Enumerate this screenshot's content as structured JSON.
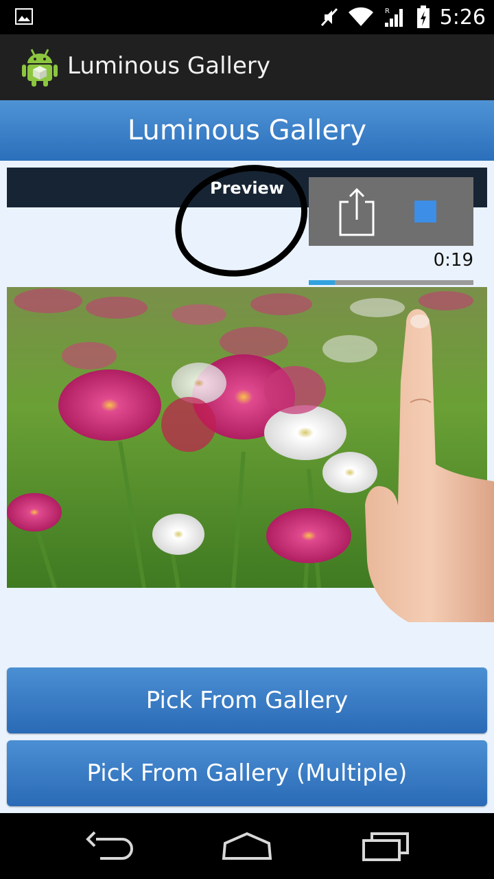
{
  "status_bar": {
    "time": "5:26",
    "icons": [
      "gallery-icon",
      "mute-icon",
      "wifi-icon",
      "signal-icon",
      "battery-charging-icon"
    ]
  },
  "action_bar": {
    "title": "Luminous Gallery",
    "icon": "android-app-icon"
  },
  "header": {
    "title": "Luminous Gallery"
  },
  "preview": {
    "label": "Preview",
    "time": "0:19",
    "progress": 0.16
  },
  "photo": {
    "subject": "pink-and-white-flowers"
  },
  "buttons": {
    "pick": "Pick From Gallery",
    "pick_multiple": "Pick From Gallery (Multiple)"
  },
  "nav": {
    "icons": [
      "back-icon",
      "home-icon",
      "recents-icon"
    ]
  },
  "colors": {
    "accent": "#2b6fbb",
    "progress": "#33a3df",
    "stop": "#3d8ee6"
  }
}
